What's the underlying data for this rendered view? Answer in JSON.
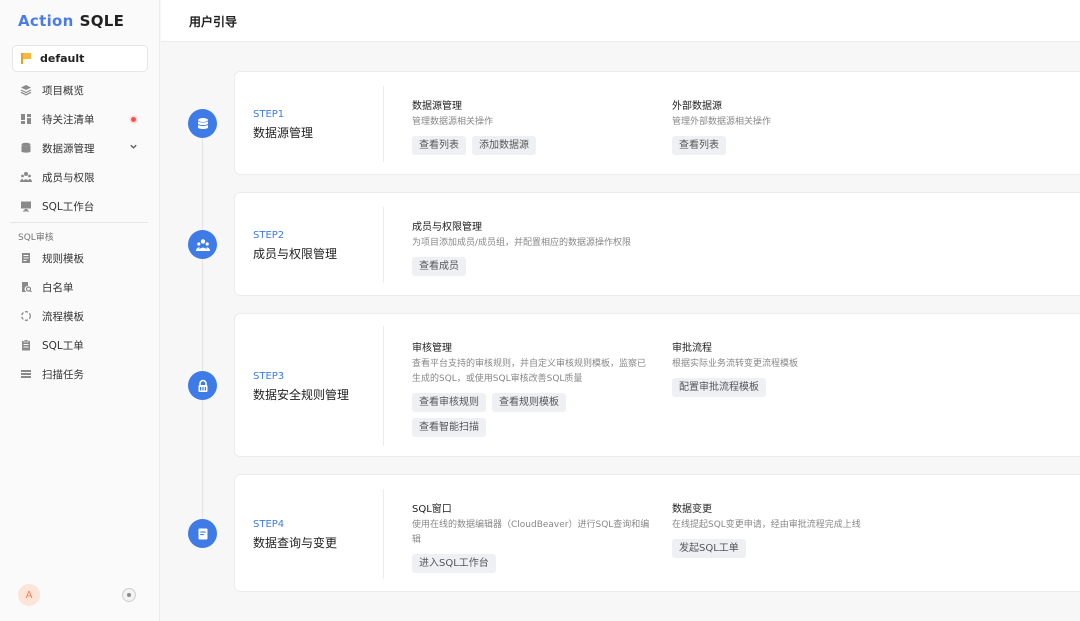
{
  "app": {
    "logo_part1": "Action",
    "logo_part2": "SQLE"
  },
  "sidebar": {
    "project": "default",
    "items": [
      {
        "label": "项目概览"
      },
      {
        "label": "待关注清单"
      },
      {
        "label": "数据源管理"
      },
      {
        "label": "成员与权限"
      },
      {
        "label": "SQL工作台"
      }
    ],
    "section_label": "SQL审核",
    "audit_items": [
      {
        "label": "规则模板"
      },
      {
        "label": "白名单"
      },
      {
        "label": "流程模板"
      },
      {
        "label": "SQL工单"
      },
      {
        "label": "扫描任务"
      }
    ],
    "avatar": "A"
  },
  "header": {
    "title": "用户引导"
  },
  "steps": [
    {
      "step": "STEP1",
      "title": "数据源管理",
      "items": [
        {
          "title": "数据源管理",
          "desc": "管理数据源相关操作",
          "buttons": [
            "查看列表",
            "添加数据源"
          ]
        },
        {
          "title": "外部数据源",
          "desc": "管理外部数据源相关操作",
          "buttons": [
            "查看列表"
          ]
        }
      ]
    },
    {
      "step": "STEP2",
      "title": "成员与权限管理",
      "items": [
        {
          "title": "成员与权限管理",
          "desc": "为项目添加成员/成员组，并配置相应的数据源操作权限",
          "buttons": [
            "查看成员"
          ]
        }
      ]
    },
    {
      "step": "STEP3",
      "title": "数据安全规则管理",
      "items": [
        {
          "title": "审核管理",
          "desc": "查看平台支持的审核规则，并自定义审核规则模板，监察已生成的SQL，或使用SQL审核改善SQL质量",
          "buttons": [
            "查看审核规则",
            "查看规则模板",
            "查看智能扫描"
          ]
        },
        {
          "title": "审批流程",
          "desc": "根据实际业务流转变更流程模板",
          "buttons": [
            "配置审批流程模板"
          ]
        }
      ]
    },
    {
      "step": "STEP4",
      "title": "数据查询与变更",
      "items": [
        {
          "title": "SQL窗口",
          "desc": "使用在线的数据编辑器（CloudBeaver）进行SQL查询和编辑",
          "buttons": [
            "进入SQL工作台"
          ]
        },
        {
          "title": "数据变更",
          "desc": "在线提起SQL变更申请，经由审批流程完成上线",
          "buttons": [
            "发起SQL工单"
          ]
        }
      ]
    }
  ]
}
